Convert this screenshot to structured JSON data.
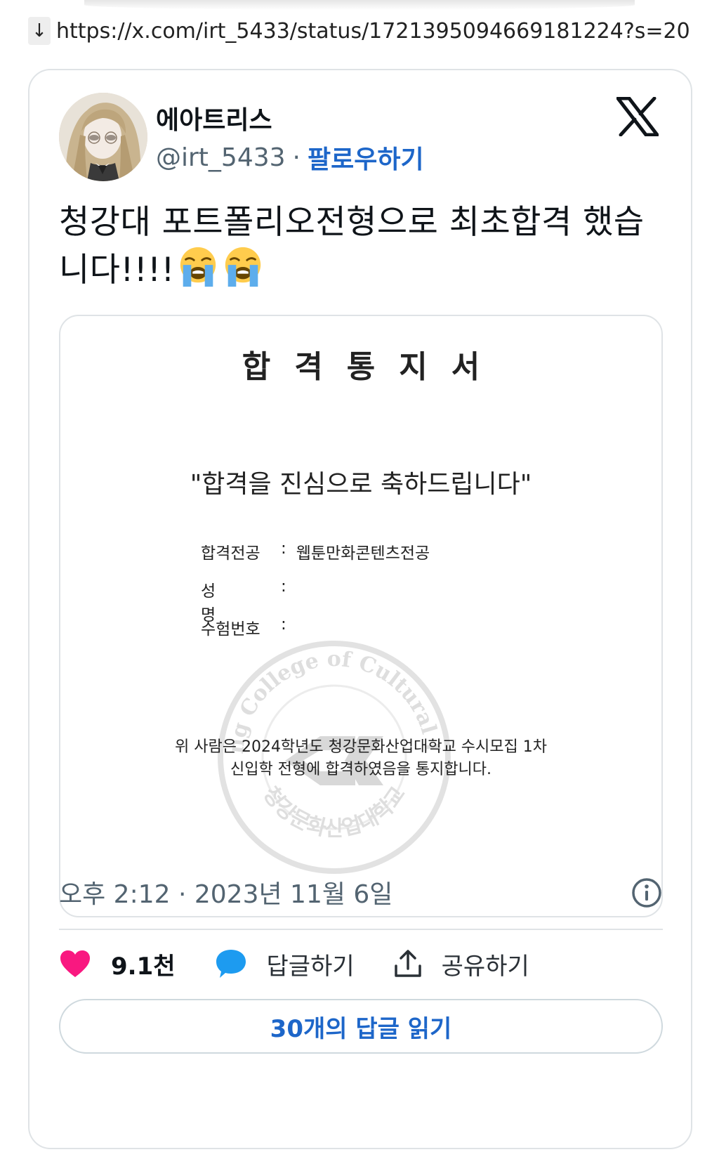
{
  "url": "https://x.com/irt_5433/status/1721395094669181224?s=20",
  "download_icon": "↓",
  "tweet": {
    "display_name": "에아트리스",
    "handle": "@irt_5433",
    "separator": "·",
    "follow_label": "팔로우하기",
    "text": "청강대 포트폴리오전형으로 최초합격 했습니다!!!!",
    "emojis": [
      "loudly-crying-face",
      "loudly-crying-face"
    ],
    "timestamp": "오후 2:12 · 2023년 11월 6일",
    "likes": "9.1천",
    "reply_label": "답글하기",
    "share_label": "공유하기",
    "read_replies_label": "30개의 답글 읽기"
  },
  "document": {
    "title": "합격통지서",
    "congrats": "\"합격을 진심으로 축하드립니다\"",
    "fields": [
      {
        "label": "합격전공",
        "value": "웹툰만화콘텐츠전공"
      },
      {
        "label": "성명",
        "value": ""
      },
      {
        "label": "수험번호",
        "value": ""
      }
    ],
    "footer_line1": "위 사람은 2024학년도 청강문화산업대학교 수시모집 1차",
    "footer_line2": "신입학 전형에 합격하였음을 통지합니다.",
    "seal_text_top": "ChungKang College of Cultural Industries",
    "seal_text_bottom": "청강문화산업대학교"
  },
  "colors": {
    "link_blue": "#1d66c9",
    "like_pink": "#f91880",
    "reply_blue": "#1d9bf0",
    "muted": "#536471",
    "border": "#dfe3e6"
  }
}
